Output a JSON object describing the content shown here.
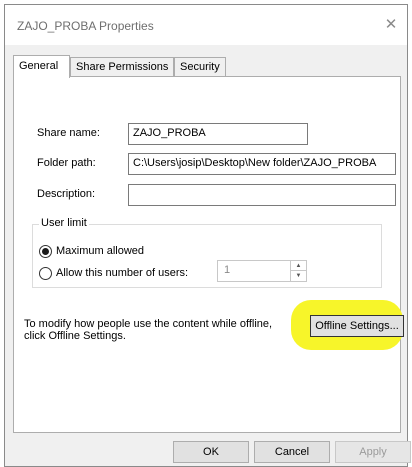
{
  "window": {
    "title": "ZAJO_PROBA Properties",
    "close_glyph": "✕"
  },
  "tabs": [
    {
      "label": "General",
      "active": true
    },
    {
      "label": "Share Permissions",
      "active": false
    },
    {
      "label": "Security",
      "active": false
    }
  ],
  "general": {
    "share_name_label": "Share name:",
    "share_name_value": "ZAJO_PROBA",
    "folder_path_label": "Folder path:",
    "folder_path_value": "C:\\Users\\josip\\Desktop\\New folder\\ZAJO_PROBA",
    "description_label": "Description:",
    "description_value": ""
  },
  "user_limit": {
    "legend": "User limit",
    "option_max": "Maximum allowed",
    "option_allow": "Allow this number of users:",
    "selected": "max",
    "users_value": "1"
  },
  "offline": {
    "description": "To modify how people use the content while offline, click Offline Settings.",
    "button_label": "Offline Settings..."
  },
  "buttons": {
    "ok": "OK",
    "cancel": "Cancel",
    "apply": "Apply"
  },
  "colors": {
    "highlight": "#f7f52a",
    "disabled_text": "#9a9a9a"
  }
}
